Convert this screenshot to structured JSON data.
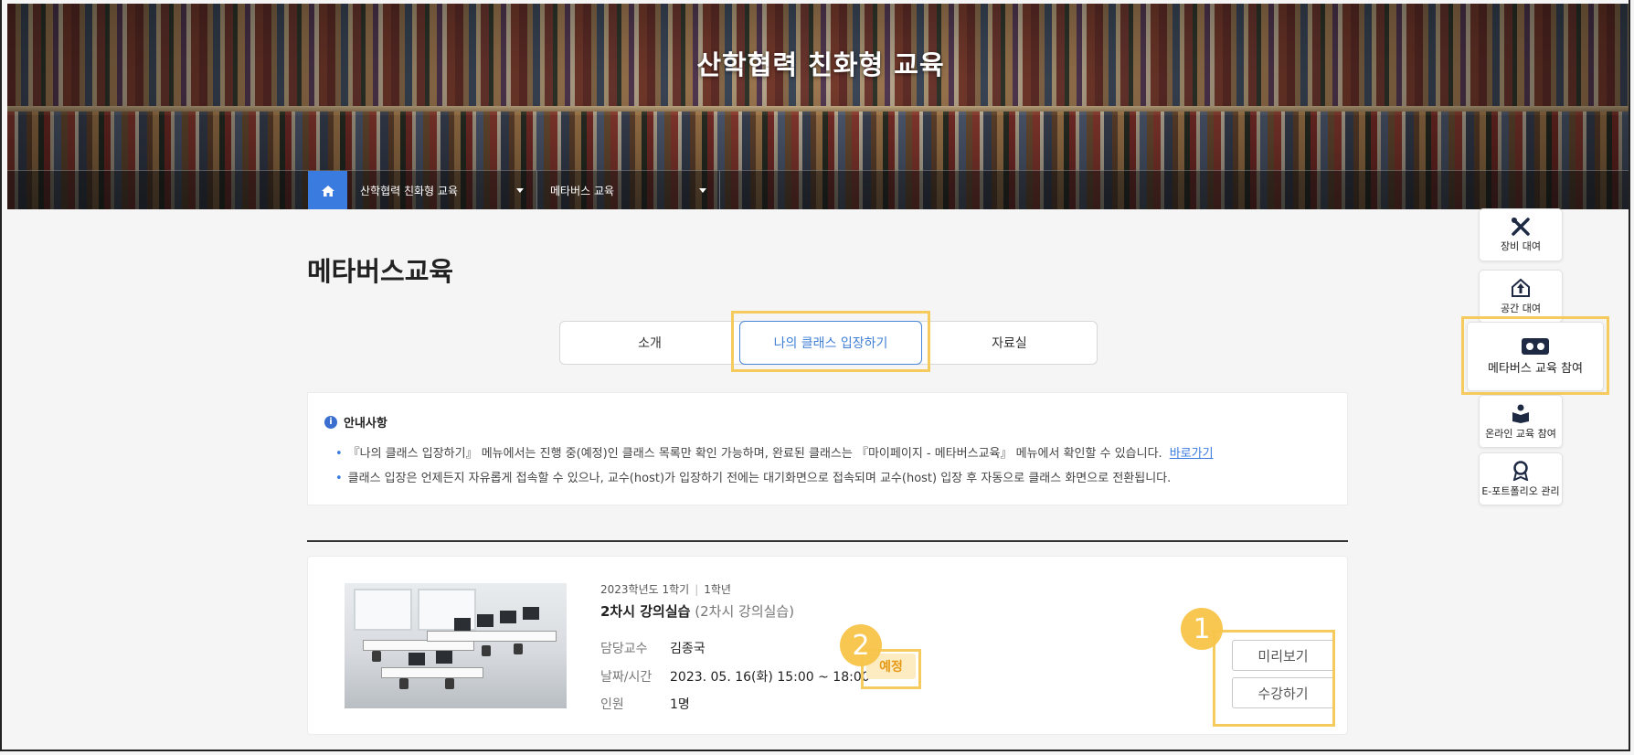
{
  "hero": {
    "title": "산학협력 친화형 교육",
    "breadcrumb": {
      "home_icon": "home-icon",
      "level1": "산학협력 친화형 교육",
      "level2": "메타버스 교육"
    }
  },
  "page": {
    "title": "메타버스교육"
  },
  "tabs": [
    {
      "label": "소개"
    },
    {
      "label": "나의 클래스 입장하기",
      "active": true
    },
    {
      "label": "자료실"
    }
  ],
  "notice": {
    "heading": "안내사항",
    "line1": "『나의 클래스 입장하기』 메뉴에서는 진행 중(예정)인 클래스 목록만 확인 가능하며, 완료된 클래스는 『마이페이지 - 메타버스교육』 메뉴에서 확인할 수 있습니다.",
    "link": "바로가기",
    "line2": "클래스 입장은 언제든지 자유롭게 접속할 수 있으나, 교수(host)가 입장하기 전에는 대기화면으로 접속되며 교수(host) 입장 후 자동으로 클래스 화면으로 전환됩니다."
  },
  "class_card": {
    "term": "2023학년도 1학기",
    "grade": "1학년",
    "title": "2차시 강의실습",
    "subtitle": "(2차시 강의실습)",
    "professor_label": "담당교수",
    "professor": "김종국",
    "datetime_label": "날짜/시간",
    "datetime": "2023. 05. 16(화) 15:00 ~ 18:00",
    "people_label": "인원",
    "people": "1명",
    "status": "예정",
    "preview_button": "미리보기",
    "enroll_button": "수강하기"
  },
  "steps": {
    "one": "1",
    "two": "2"
  },
  "quick_menu": [
    {
      "label": "장비 대여",
      "icon": "tools-icon"
    },
    {
      "label": "공간 대여",
      "icon": "building-icon"
    },
    {
      "label": "메타버스 교육 참여",
      "icon": "vr-headset-icon"
    },
    {
      "label": "온라인 교육 참여",
      "icon": "book-user-icon"
    },
    {
      "label": "E-포트폴리오 관리",
      "icon": "award-icon"
    }
  ],
  "colors": {
    "accent_blue": "#3a7be0",
    "highlight": "#f4cb5c",
    "status_bg": "#fdebc2",
    "status_text": "#e69a14"
  }
}
